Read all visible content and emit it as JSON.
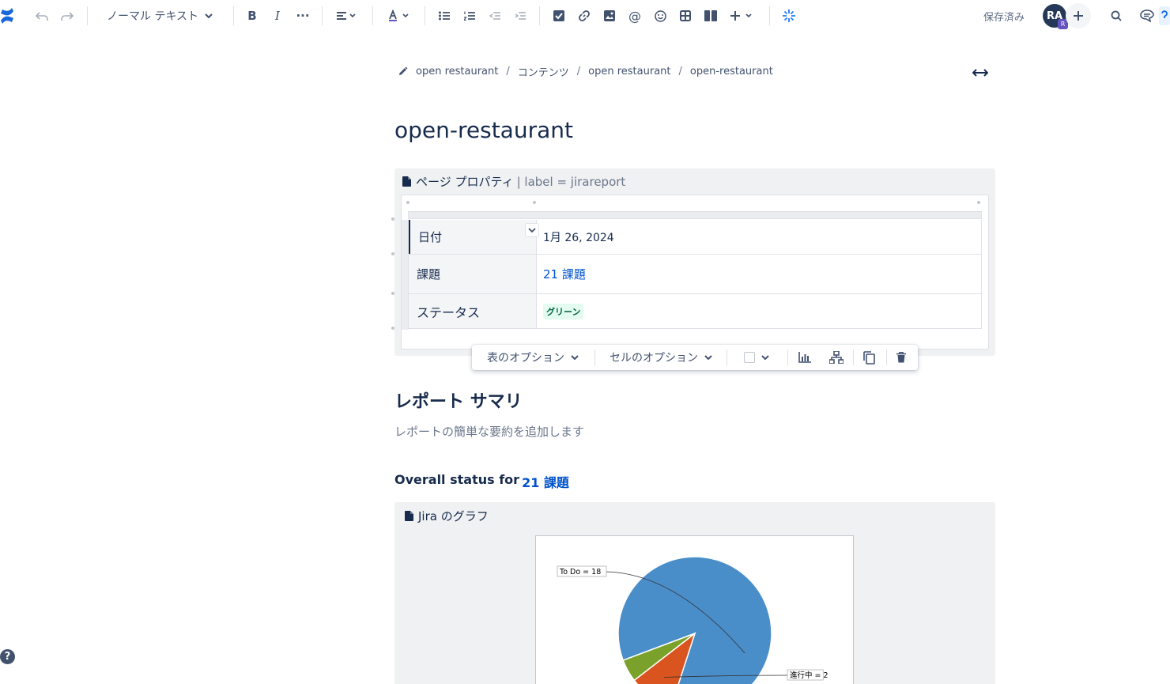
{
  "toolbar": {
    "text_style": "ノーマル テキスト",
    "saved_label": "保存済み",
    "avatar_initials": "RA",
    "avatar_badge": "R",
    "accent_color": "#0052cc"
  },
  "breadcrumb": {
    "items": [
      "open restaurant",
      "コンテンツ",
      "open restaurant",
      "open-restaurant"
    ]
  },
  "page": {
    "title": "open-restaurant"
  },
  "page_properties": {
    "macro_title": "ページ プロパティ",
    "macro_params": "| label = jirareport",
    "rows": [
      {
        "key": "日付",
        "value": "1月 26, 2024"
      },
      {
        "key": "課題",
        "value": "21 課題"
      },
      {
        "key": "ステータス",
        "value": "グリーン"
      }
    ]
  },
  "table_toolbar": {
    "table_options": "表のオプション",
    "cell_options": "セルのオプション"
  },
  "report": {
    "heading": "レポート サマリ",
    "placeholder": "レポートの簡単な要約を追加します",
    "overall_label": "Overall status for",
    "overall_link": "21 課題"
  },
  "jira_chart": {
    "macro_title": "Jira のグラフ"
  },
  "chart_data": {
    "type": "pie",
    "labels": [
      "To Do = 18",
      "進行中 = 2",
      ""
    ],
    "categories": [
      "To Do",
      "進行中",
      ""
    ],
    "values": [
      18,
      2,
      1
    ],
    "colors": [
      "#4a8ec9",
      "#d9541f",
      "#7aa22b"
    ]
  }
}
